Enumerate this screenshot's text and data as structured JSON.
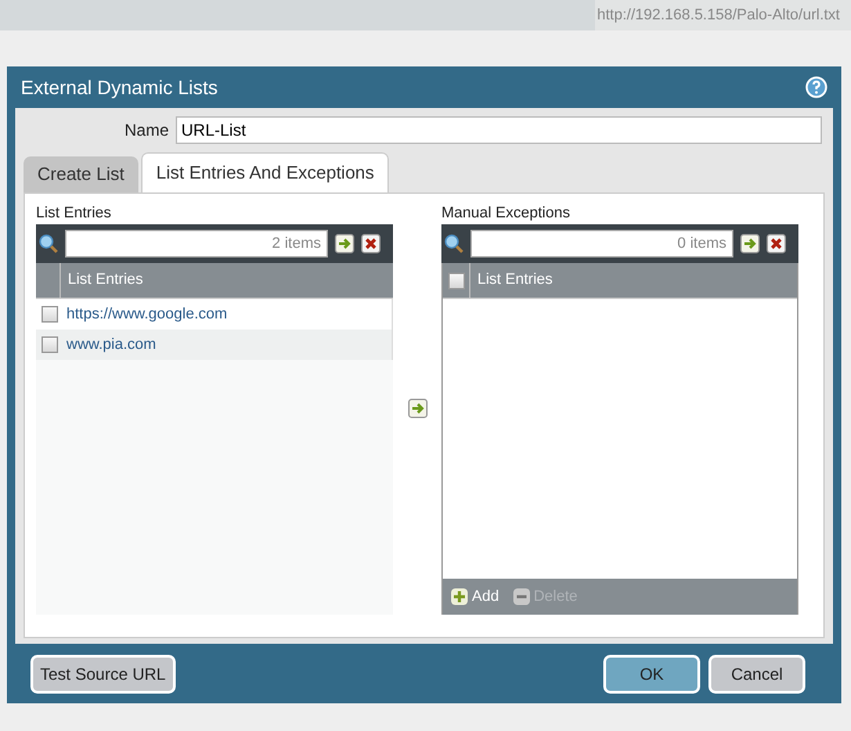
{
  "browser_bar": {
    "url": "http://192.168.5.158/Palo-Alto/url.txt"
  },
  "dialog": {
    "title": "External Dynamic Lists",
    "name_field": {
      "label": "Name",
      "value": "URL-List"
    },
    "tabs": [
      {
        "label": "Create List",
        "selected": false
      },
      {
        "label": "List Entries And Exceptions",
        "selected": true
      }
    ],
    "list_entries": {
      "title": "List Entries",
      "search": {
        "count": "2 items"
      },
      "column": "List Entries",
      "rows": [
        {
          "text": "https://www.google.com",
          "checked": false
        },
        {
          "text": "www.pia.com",
          "checked": false
        }
      ]
    },
    "manual_exceptions": {
      "title": "Manual Exceptions",
      "search": {
        "count": "0 items"
      },
      "column": "List Entries",
      "header_checked": false,
      "actions": [
        {
          "label": "Add",
          "kind": "add",
          "disabled": false
        },
        {
          "label": "Delete",
          "kind": "delete",
          "disabled": true
        }
      ]
    },
    "buttons": [
      {
        "label": "Test Source URL",
        "kind": "secondary"
      },
      {
        "label": "OK",
        "kind": "primary"
      },
      {
        "label": "Cancel",
        "kind": "secondary"
      }
    ]
  }
}
